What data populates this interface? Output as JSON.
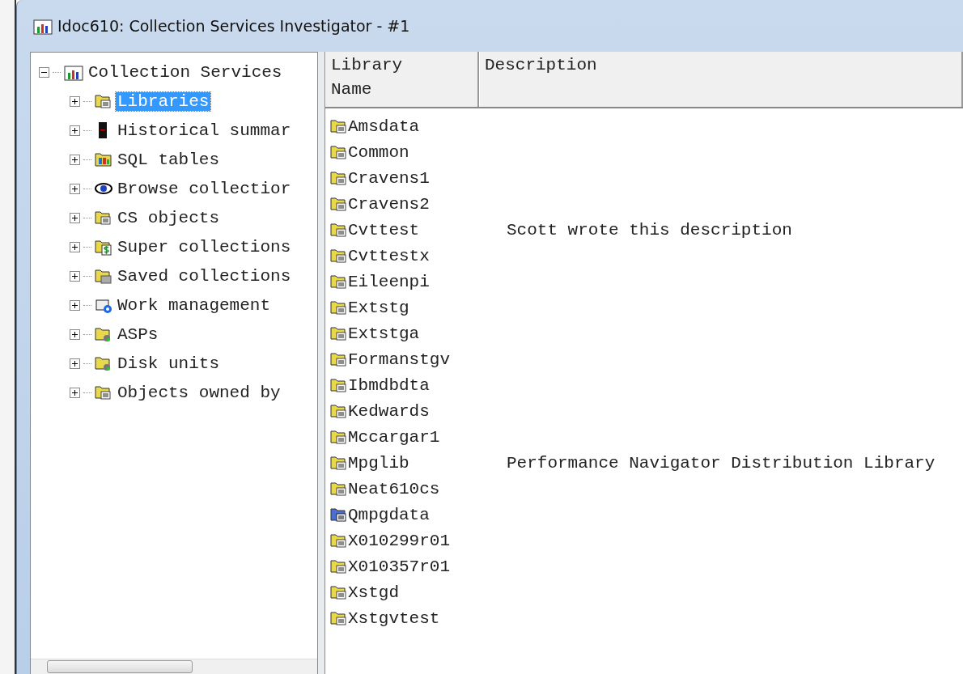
{
  "window": {
    "title": "Idoc610:  Collection Services Investigator - #1"
  },
  "tree": {
    "label": "Collection Services",
    "expanded": true,
    "children": [
      {
        "label": "Libraries",
        "kind": "library",
        "expanded": false,
        "selected": true
      },
      {
        "label": "Historical summar",
        "kind": "server",
        "expanded": false,
        "selected": false
      },
      {
        "label": "SQL tables",
        "kind": "sql",
        "expanded": false,
        "selected": false
      },
      {
        "label": "Browse collectior",
        "kind": "eye",
        "expanded": false,
        "selected": false
      },
      {
        "label": "CS objects",
        "kind": "library",
        "expanded": false,
        "selected": false
      },
      {
        "label": "Super collections",
        "kind": "super",
        "expanded": false,
        "selected": false
      },
      {
        "label": "Saved collections",
        "kind": "saved",
        "expanded": false,
        "selected": false
      },
      {
        "label": "Work management",
        "kind": "work",
        "expanded": false,
        "selected": false
      },
      {
        "label": "ASPs",
        "kind": "disk",
        "expanded": false,
        "selected": false
      },
      {
        "label": "Disk units",
        "kind": "disk",
        "expanded": false,
        "selected": false
      },
      {
        "label": "Objects owned by",
        "kind": "library",
        "expanded": false,
        "selected": false
      }
    ]
  },
  "table": {
    "columns": [
      "Library\nName",
      "Description"
    ],
    "rows": [
      {
        "name": "Amsdata",
        "kind": "library"
      },
      {
        "name": "Common",
        "kind": "library"
      },
      {
        "name": "Cravens1",
        "kind": "library"
      },
      {
        "name": "Cravens2",
        "kind": "library"
      },
      {
        "name": "Cvttest",
        "description": "Scott wrote this description",
        "kind": "library"
      },
      {
        "name": "Cvttestx",
        "kind": "library"
      },
      {
        "name": "Eileenpi",
        "kind": "library"
      },
      {
        "name": "Extstg",
        "kind": "library"
      },
      {
        "name": "Extstga",
        "kind": "library"
      },
      {
        "name": "Formanstgv",
        "kind": "library"
      },
      {
        "name": "Ibmdbdta",
        "kind": "library"
      },
      {
        "name": "Kedwards",
        "kind": "library"
      },
      {
        "name": "Mccargar1",
        "kind": "library"
      },
      {
        "name": "Mpglib",
        "description": "Performance Navigator Distribution Library",
        "kind": "library"
      },
      {
        "name": "Neat610cs",
        "kind": "library"
      },
      {
        "name": "Qmpgdata",
        "kind": "system-library"
      },
      {
        "name": "X010299r01",
        "kind": "library"
      },
      {
        "name": "X010357r01",
        "kind": "library"
      },
      {
        "name": "Xstgd",
        "kind": "library"
      },
      {
        "name": "Xstgvtest",
        "kind": "library"
      }
    ]
  }
}
